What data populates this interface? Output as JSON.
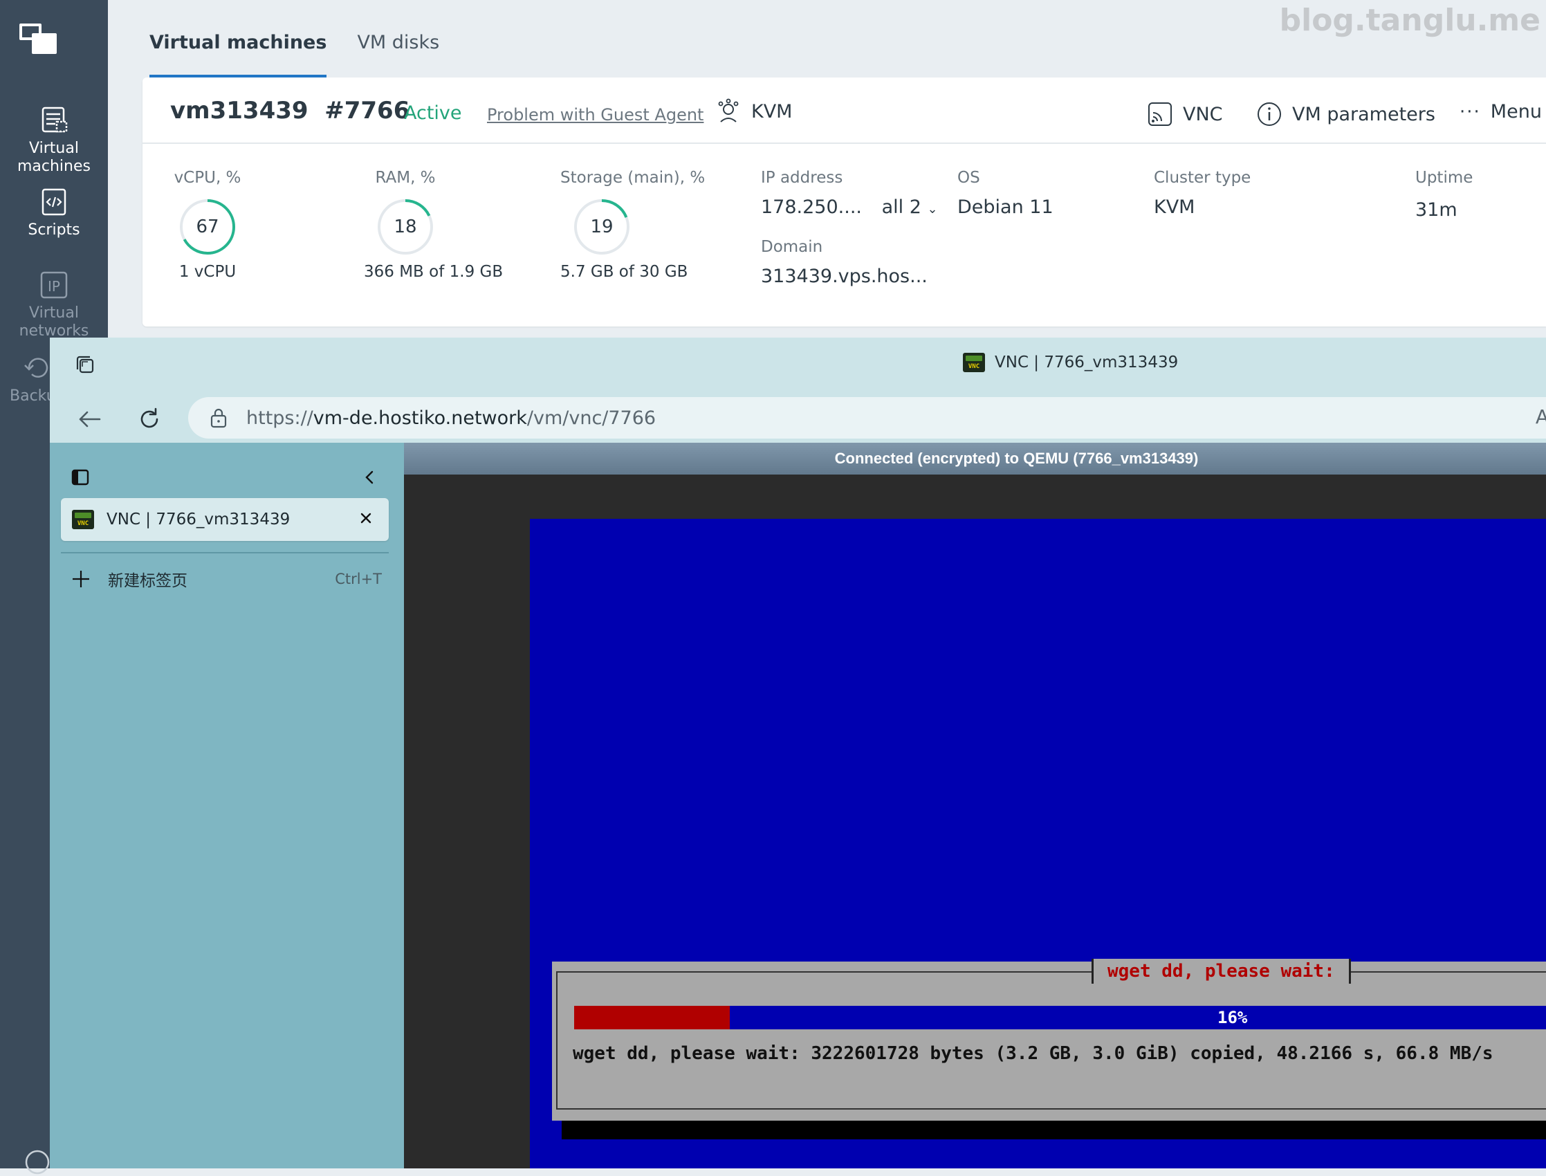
{
  "rail": {
    "items": [
      {
        "label_1": "Virtual",
        "label_2": "machines"
      },
      {
        "label_1": "Scripts"
      },
      {
        "label_1": "Virtual",
        "label_2": "networks"
      },
      {
        "label_1": "Backu"
      }
    ]
  },
  "watermark": "blog.tanglu.me",
  "tabs": [
    "Virtual machines",
    "VM disks"
  ],
  "vm": {
    "name": "vm313439",
    "id": "#7766",
    "status": "Active",
    "problem": "Problem with Guest Agent",
    "hypervisor": "KVM",
    "actions": {
      "vnc": "VNC",
      "params": "VM parameters",
      "menu": "Menu"
    }
  },
  "metrics": [
    {
      "label": "vCPU, %",
      "value": "67",
      "percent": 67,
      "sub": "1 vCPU"
    },
    {
      "label": "RAM, %",
      "value": "18",
      "percent": 18,
      "sub": "366 MB of 1.9 GB"
    },
    {
      "label": "Storage (main), %",
      "value": "19",
      "percent": 19,
      "sub": "5.7 GB of 30 GB"
    }
  ],
  "info": {
    "ip_label": "IP address",
    "ip_value": "178.250....",
    "ip_all": "all 2",
    "domain_label": "Domain",
    "domain_value": "313439.vps.hos...",
    "os_label": "OS",
    "os_value": "Debian 11",
    "cluster_label": "Cluster type",
    "cluster_value": "KVM",
    "uptime_label": "Uptime",
    "uptime_value": "31m"
  },
  "browser": {
    "title": "VNC | 7766_vm313439",
    "url_scheme": "https://",
    "url_host": "vm-de.hostiko.network",
    "url_path": "/vm/vnc/7766",
    "url_end": "A",
    "favicon_text": "VNC",
    "tab_title": "VNC | 7766_vm313439",
    "new_tab": "新建标签页",
    "new_tab_shortcut": "Ctrl+T"
  },
  "vnc": {
    "status": "Connected (encrypted) to QEMU (7766_vm313439)",
    "dialog_title": "wget dd, please wait:",
    "progress_label": "16%",
    "progress_fraction": 0.16,
    "message": "wget dd, please wait: 3222601728 bytes (3.2 GB, 3.0 GiB) copied, 48.2166 s, 66.8 MB/s"
  },
  "colors": {
    "accent": "#2176c6",
    "active": "#23a47a",
    "gauge": "#26b58e",
    "console_blue": "#0000b0",
    "progress_red": "#b00000"
  }
}
